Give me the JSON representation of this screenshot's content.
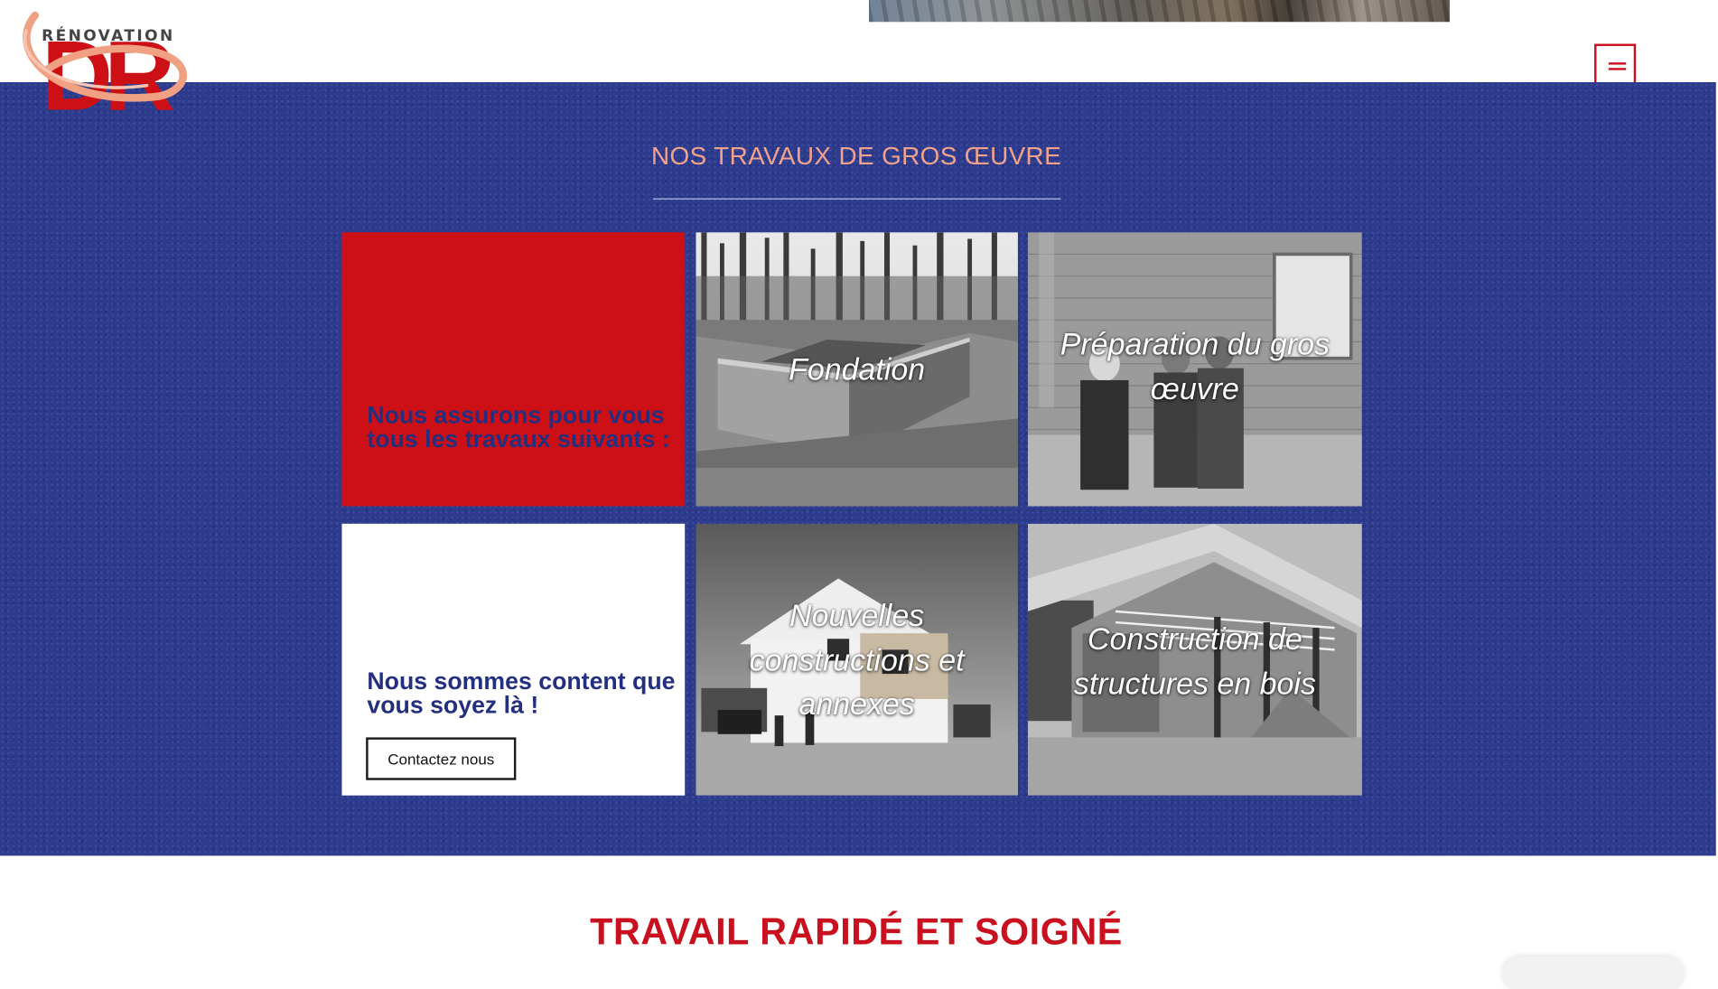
{
  "header": {
    "logo_word": "RÉNOVATION",
    "logo_initials": "DR",
    "menu_icon": "hamburger-icon"
  },
  "works": {
    "title": "NOS TRAVAUX DE GROS ŒUVRE",
    "intro_text": "Nous assurons pour vous tous les travaux suivants :",
    "welcome_text": "Nous sommes content que vous soyez là !",
    "contact_label": "Contactez nous",
    "tiles": [
      {
        "label": "Fondation"
      },
      {
        "label": "Préparation du gros œuvre"
      },
      {
        "label": "Nouvelles constructions et annexes"
      },
      {
        "label": "Construction de structures en bois"
      }
    ]
  },
  "bottom": {
    "title": "TRAVAIL RAPIDÉ ET SOIGNÉ"
  },
  "colors": {
    "brand_red": "#c8101e",
    "section_blue": "#2d3b8e",
    "title_salmon": "#f2a28a",
    "tile_text_blue": "#24307f"
  }
}
